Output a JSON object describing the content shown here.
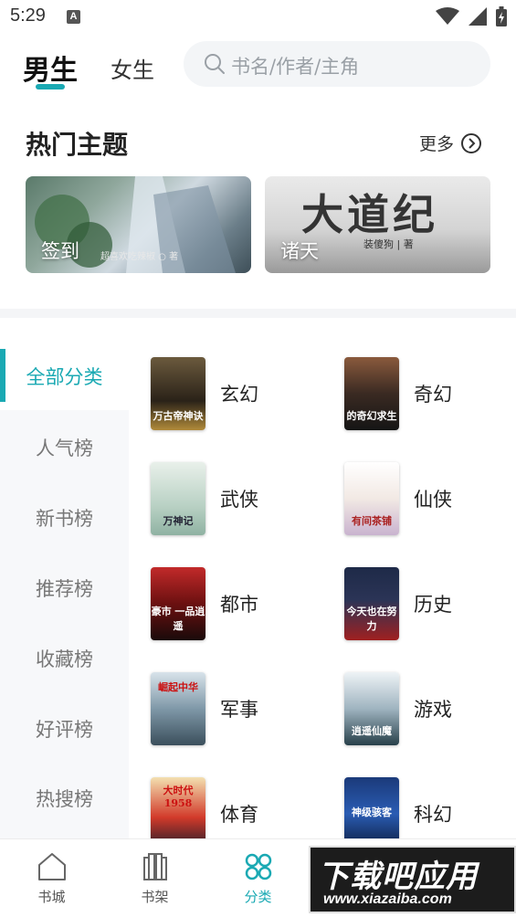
{
  "status_bar": {
    "time": "5:29",
    "notification_badge": "A"
  },
  "header": {
    "tabs": [
      {
        "label": "男生",
        "active": true
      },
      {
        "label": "女生",
        "active": false
      }
    ],
    "search": {
      "placeholder": "书名/作者/主角"
    }
  },
  "hot_themes": {
    "title": "热门主题",
    "more_label": "更多",
    "banners": [
      {
        "label": "签到",
        "fine_print": "超喜欢吃辣椒 ○ 著"
      },
      {
        "label": "诸天",
        "calligraphy": "大道纪",
        "author": "装傻狗 | 著"
      }
    ]
  },
  "side_nav": {
    "items": [
      {
        "label": "全部分类",
        "active": true
      },
      {
        "label": "人气榜"
      },
      {
        "label": "新书榜"
      },
      {
        "label": "推荐榜"
      },
      {
        "label": "收藏榜"
      },
      {
        "label": "好评榜"
      },
      {
        "label": "热搜榜"
      }
    ]
  },
  "categories": [
    {
      "label": "玄幻",
      "cover_text": "万古帝神诀"
    },
    {
      "label": "奇幻",
      "cover_text": "的奇幻求生"
    },
    {
      "label": "武侠",
      "cover_text": "万神记"
    },
    {
      "label": "仙侠",
      "cover_text": "有间茶铺"
    },
    {
      "label": "都市",
      "cover_text": "豪市 一品逍遥"
    },
    {
      "label": "历史",
      "cover_text": "今天也在努力"
    },
    {
      "label": "军事",
      "cover_text": "崛起中华"
    },
    {
      "label": "游戏",
      "cover_text": "逍遥仙魔"
    },
    {
      "label": "体育",
      "cover_text": "大时代1958"
    },
    {
      "label": "科幻",
      "cover_text": "神级骇客"
    }
  ],
  "bottom_nav": {
    "items": [
      {
        "label": "书城",
        "icon": "home-icon"
      },
      {
        "label": "书架",
        "icon": "bookshelf-icon"
      },
      {
        "label": "分类",
        "icon": "category-icon",
        "active": true
      }
    ]
  },
  "watermark": {
    "main": "下载吧应用",
    "url": "www.xiazaiba.com"
  },
  "colors": {
    "accent": "#1aa9b3"
  }
}
